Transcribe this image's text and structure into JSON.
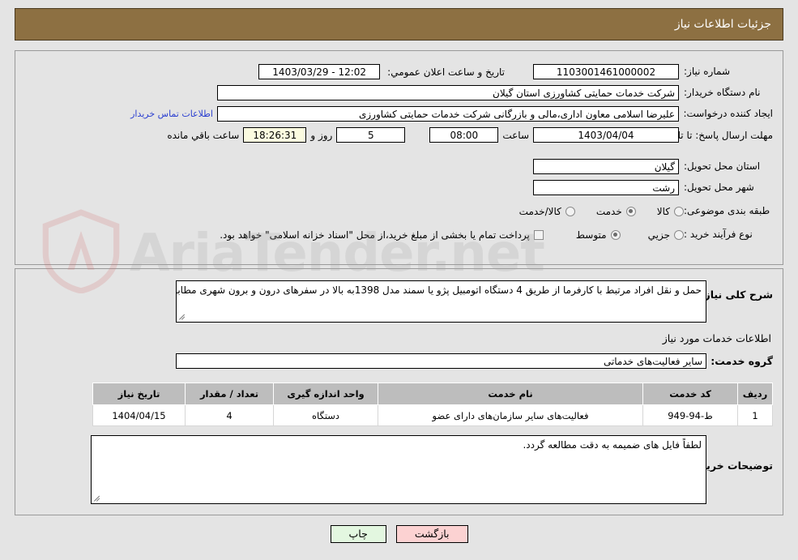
{
  "header": {
    "title": "جزئیات اطلاعات نیاز"
  },
  "form": {
    "need_number_label": "شماره نیاز:",
    "need_number_value": "1103001461000002",
    "public_announce_label": "تاریخ و ساعت اعلان عمومي:",
    "public_announce_value": "12:02 - 1403/03/29",
    "buyer_org_label": "نام دستگاه خریدار:",
    "buyer_org_value": "شرکت خدمات حمایتی کشاورزی استان گیلان",
    "creator_label": "ایجاد کننده درخواست:",
    "creator_value": "علیرضا اسلامی معاون اداری،مالی و بازرگانی شرکت خدمات حمایتی کشاورزی",
    "contact_link": "اطلاعات تماس خریدار",
    "deadline_label": "مهلت ارسال پاسخ: تا تاریخ:",
    "deadline_date": "1403/04/04",
    "hour_label": "ساعت",
    "deadline_time": "08:00",
    "days_remaining": "5",
    "days_label": "روز و",
    "time_remaining": "18:26:31",
    "remaining_label": "ساعت باقي مانده",
    "province_label": "استان محل تحویل:",
    "province_value": "گیلان",
    "city_label": "شهر محل تحویل:",
    "city_value": "رشت",
    "category_label": "طبقه بندی موضوعی:",
    "category_options": [
      {
        "label": "کالا",
        "checked": false
      },
      {
        "label": "خدمت",
        "checked": true
      },
      {
        "label": "کالا/خدمت",
        "checked": false
      }
    ],
    "process_label": "نوع فرآیند خرید :",
    "process_options": [
      {
        "label": "جزیي",
        "checked": false
      },
      {
        "label": "متوسط",
        "checked": true
      }
    ],
    "treasury_checkbox_label": "پرداخت تمام یا بخشی از مبلغ خرید،از محل \"اسناد خزانه اسلامی\" خواهد بود.",
    "treasury_checked": false
  },
  "description": {
    "label": "شرح کلی نیاز:",
    "value": "حمل و نقل افراد مرتبط با کارفرما از طریق 4 دستگاه اتومبیل  پژو یا سمند مدل 1398به بالا در سفرهای درون و برون شهری مطابق با شرایط و قرارداد ضمیمه."
  },
  "services": {
    "section_title": "اطلاعات خدمات مورد نیاز",
    "group_label": "گروه خدمت:",
    "group_value": "سایر فعالیت‌های خدماتی",
    "columns": [
      "ردیف",
      "کد خدمت",
      "نام خدمت",
      "واحد اندازه گیری",
      "تعداد / مقدار",
      "تاریخ نیاز"
    ],
    "rows": [
      {
        "row_no": "1",
        "service_code": "ط-94-949",
        "service_name": "فعالیت‌های سایر سازمان‌های دارای عضو",
        "unit": "دستگاه",
        "quantity": "4",
        "need_date": "1404/04/15"
      }
    ]
  },
  "buyer_notes": {
    "label": "توضیحات خریدار:",
    "value": "لطفاً فایل های ضمیمه به دقت مطالعه گردد."
  },
  "buttons": {
    "back": "بازگشت",
    "print": "چاپ"
  },
  "watermark": {
    "text": "AriaTender.net"
  },
  "colors": {
    "header_bar": "#8d7042",
    "page_bg": "#e4e4e4",
    "table_header": "#bdbdbd",
    "link": "#2b3fd0",
    "highlight_field": "#fbfbe0",
    "btn_back": "#fcd2d2",
    "btn_print": "#e3f7e0"
  }
}
